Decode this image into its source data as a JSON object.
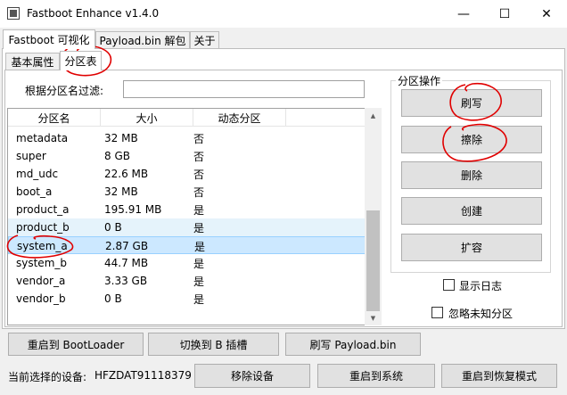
{
  "window": {
    "title": "Fastboot Enhance v1.4.0",
    "minimize": "—",
    "maximize": "☐",
    "close": "✕"
  },
  "main_tabs": [
    {
      "label": "Fastboot 可视化",
      "active": true
    },
    {
      "label": "Payload.bin 解包",
      "active": false
    },
    {
      "label": "关于",
      "active": false
    }
  ],
  "sub_tabs": [
    {
      "label": "基本属性",
      "active": false
    },
    {
      "label": "分区表",
      "active": true
    }
  ],
  "filter": {
    "label": "根据分区名过滤:",
    "value": "",
    "placeholder": ""
  },
  "table": {
    "columns": [
      "分区名",
      "大小",
      "动态分区"
    ],
    "rows": [
      {
        "name": "metadata",
        "size": "32 MB",
        "dynamic": "否"
      },
      {
        "name": "super",
        "size": "8 GB",
        "dynamic": "否"
      },
      {
        "name": "md_udc",
        "size": "22.6 MB",
        "dynamic": "否"
      },
      {
        "name": "boot_a",
        "size": "32 MB",
        "dynamic": "否"
      },
      {
        "name": "product_a",
        "size": "195.91 MB",
        "dynamic": "是"
      },
      {
        "name": "product_b",
        "size": "0 B",
        "dynamic": "是"
      },
      {
        "name": "system_a",
        "size": "2.87 GB",
        "dynamic": "是"
      },
      {
        "name": "system_b",
        "size": "44.7 MB",
        "dynamic": "是"
      },
      {
        "name": "vendor_a",
        "size": "3.33 GB",
        "dynamic": "是"
      },
      {
        "name": "vendor_b",
        "size": "0 B",
        "dynamic": "是"
      }
    ]
  },
  "operations": {
    "title": "分区操作",
    "flash": "刷写",
    "erase": "擦除",
    "delete": "删除",
    "create": "创建",
    "resize": "扩容",
    "show_log": "显示日志",
    "ignore_unknown": "忽略未知分区"
  },
  "bottom": {
    "reboot_bootloader": "重启到 BootLoader",
    "switch_slot": "切换到 B 插槽",
    "flash_payload": "刷写 Payload.bin",
    "device_label": "当前选择的设备:",
    "device_id": "HFZDAT91118379",
    "remove_device": "移除设备",
    "reboot_system": "重启到系统",
    "reboot_recovery": "重启到恢复模式"
  },
  "colors": {
    "selected_row": "#cce8ff",
    "hover_row": "#e5f3fb",
    "annotation": "#e00000"
  }
}
